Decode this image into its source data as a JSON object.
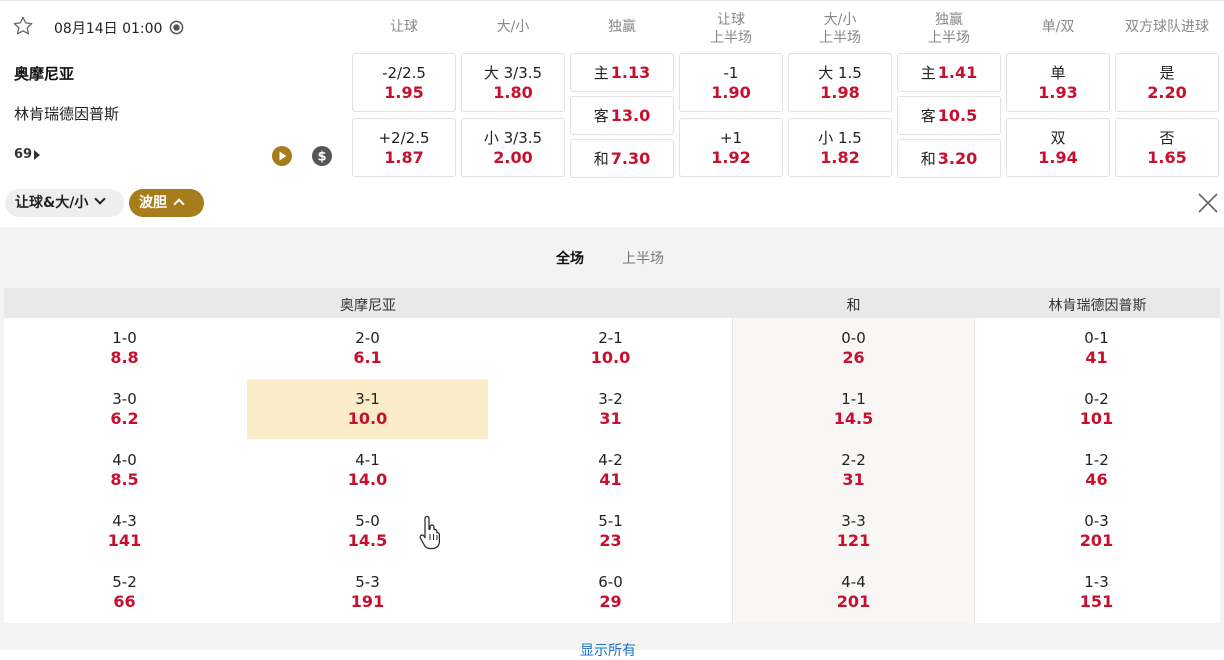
{
  "match": {
    "datetime": "08月14日 01:00",
    "home": "奥摩尼亚",
    "away": "林肯瑞德因普斯",
    "more_count": "69"
  },
  "columns": [
    {
      "label": "让球"
    },
    {
      "label": "大/小"
    },
    {
      "label": "独赢"
    },
    {
      "label": "让球\n上半场"
    },
    {
      "label": "大/小\n上半场"
    },
    {
      "label": "独赢\n上半场"
    },
    {
      "label": "单/双"
    },
    {
      "label": "双方球队进球"
    }
  ],
  "markets": {
    "handicap": [
      {
        "label": "-2/2.5",
        "odd": "1.95"
      },
      {
        "label": "+2/2.5",
        "odd": "1.87"
      }
    ],
    "total": [
      {
        "label": "大 3/3.5",
        "odd": "1.80"
      },
      {
        "label": "小 3/3.5",
        "odd": "2.00"
      }
    ],
    "moneyline": [
      {
        "label": "主",
        "odd": "1.13"
      },
      {
        "label": "客",
        "odd": "13.0"
      },
      {
        "label": "和",
        "odd": "7.30"
      }
    ],
    "handicap_1h": [
      {
        "label": "-1",
        "odd": "1.90"
      },
      {
        "label": "+1",
        "odd": "1.92"
      }
    ],
    "total_1h": [
      {
        "label": "大 1.5",
        "odd": "1.98"
      },
      {
        "label": "小 1.5",
        "odd": "1.82"
      }
    ],
    "moneyline_1h": [
      {
        "label": "主",
        "odd": "1.41"
      },
      {
        "label": "客",
        "odd": "10.5"
      },
      {
        "label": "和",
        "odd": "3.20"
      }
    ],
    "odd_even": [
      {
        "label": "单",
        "odd": "1.93"
      },
      {
        "label": "双",
        "odd": "1.94"
      }
    ],
    "btts": [
      {
        "label": "是",
        "odd": "2.20"
      },
      {
        "label": "否",
        "odd": "1.65"
      }
    ]
  },
  "filters": {
    "handicap_total": "让球&大/小",
    "correct_score": "波胆"
  },
  "tabs": {
    "full": "全场",
    "half": "上半场"
  },
  "score_grid": {
    "home_header": "奥摩尼亚",
    "draw_header": "和",
    "away_header": "林肯瑞德因普斯",
    "rows": [
      [
        {
          "s": "1-0",
          "o": "8.8"
        },
        {
          "s": "2-0",
          "o": "6.1"
        },
        {
          "s": "2-1",
          "o": "10.0"
        },
        {
          "s": "0-0",
          "o": "26"
        },
        {
          "s": "0-1",
          "o": "41"
        }
      ],
      [
        {
          "s": "3-0",
          "o": "6.2"
        },
        {
          "s": "3-1",
          "o": "10.0"
        },
        {
          "s": "3-2",
          "o": "31"
        },
        {
          "s": "1-1",
          "o": "14.5"
        },
        {
          "s": "0-2",
          "o": "101"
        }
      ],
      [
        {
          "s": "4-0",
          "o": "8.5"
        },
        {
          "s": "4-1",
          "o": "14.0"
        },
        {
          "s": "4-2",
          "o": "41"
        },
        {
          "s": "2-2",
          "o": "31"
        },
        {
          "s": "1-2",
          "o": "46"
        }
      ],
      [
        {
          "s": "4-3",
          "o": "141"
        },
        {
          "s": "5-0",
          "o": "14.5"
        },
        {
          "s": "5-1",
          "o": "23"
        },
        {
          "s": "3-3",
          "o": "121"
        },
        {
          "s": "0-3",
          "o": "201"
        }
      ],
      [
        {
          "s": "5-2",
          "o": "66"
        },
        {
          "s": "5-3",
          "o": "191"
        },
        {
          "s": "6-0",
          "o": "29"
        },
        {
          "s": "4-4",
          "o": "201"
        },
        {
          "s": "1-3",
          "o": "151"
        }
      ]
    ]
  },
  "footer": {
    "show_all": "显示所有"
  },
  "colors": {
    "odd_red": "#c8102e",
    "gold": "#a67c1c",
    "highlight": "#fbecc9"
  }
}
